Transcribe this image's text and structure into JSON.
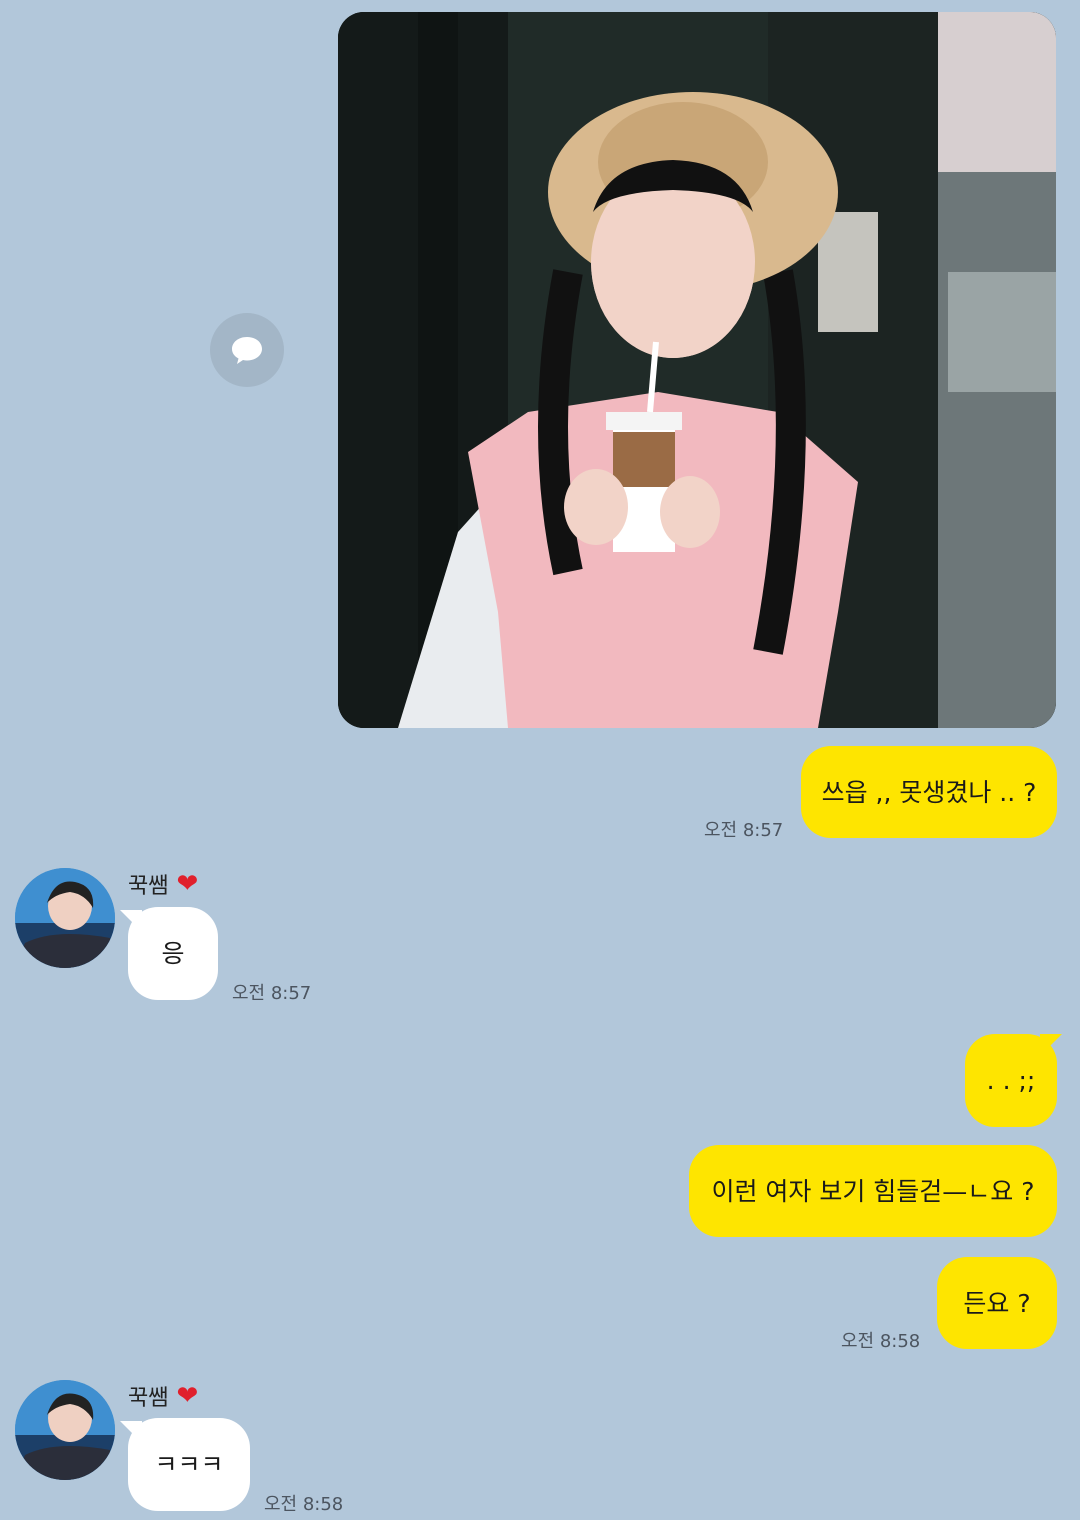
{
  "chat": {
    "contact_name": "꾹쌤",
    "heart_glyph": "❤",
    "accent_colors": {
      "background": "#b2c7da",
      "my_bubble": "#fee500",
      "their_bubble": "#ffffff"
    },
    "messages": [
      {
        "sender": "me",
        "type": "image",
        "description_icon": "photo-image"
      },
      {
        "sender": "me",
        "text": "쓰읍 ,, 못생겼나 .. ?",
        "time": "오전 8:57"
      },
      {
        "sender": "them",
        "text": "응",
        "time": "오전 8:57"
      },
      {
        "sender": "me",
        "text": ". . ;;"
      },
      {
        "sender": "me",
        "text": "이런 여자 보기 힘들걷—ㄴ요 ?"
      },
      {
        "sender": "me",
        "text": "든요 ?",
        "time": "오전 8:58"
      },
      {
        "sender": "them",
        "text": "ㅋㅋㅋ",
        "time": "오전 8:58"
      }
    ]
  }
}
